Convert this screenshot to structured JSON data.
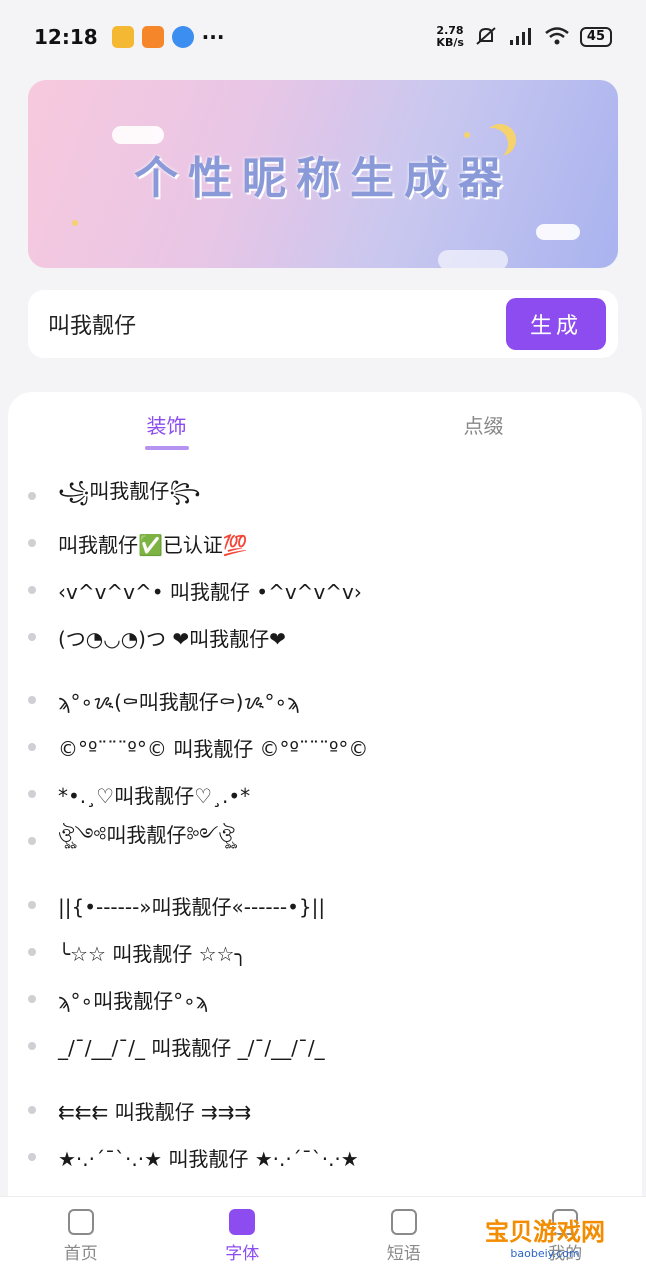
{
  "status": {
    "time": "12:18",
    "more": "···",
    "net_speed_value": "2.78",
    "net_speed_unit": "KB/s",
    "battery": "45"
  },
  "banner": {
    "title": "个性昵称生成器"
  },
  "input": {
    "value": "叫我靓仔",
    "generate_label": "生成"
  },
  "tabs": [
    {
      "label": "装饰"
    },
    {
      "label": "点缀"
    }
  ],
  "results": [
    "꧁叫我靓仔꧂",
    "叫我靓仔✅已认证💯",
    "‹v^v^v^• 叫我靓仔 •^v^v^v›",
    "(つ◔◡◔)つ ❤叫我靓仔❤",
    "ϡ°∘ᝰ(⚰叫我靓仔⚰)ᝰ°∘ϡ",
    "©°º¨¨¨º°© 叫我靓仔 ©°º¨¨¨º°©",
    "*•.¸♡叫我靓仔♡¸.•*",
    "ঔৣ༺叫我靓仔༻ঔৣ",
    "||{•------»叫我靓仔«------•}||",
    "╰☆☆ 叫我靓仔 ☆☆╮",
    "ϡ°∘叫我靓仔°∘ϡ",
    "_/¯/__/¯/_ 叫我靓仔 _/¯/__/¯/_",
    "⇇⇇⇇ 叫我靓仔 ⇉⇉⇉",
    "★·.·´¯`·.·★ 叫我靓仔 ★·.·´¯`·.·★"
  ],
  "nav": [
    {
      "label": "首页"
    },
    {
      "label": "字体"
    },
    {
      "label": "短语"
    },
    {
      "label": "我的"
    }
  ],
  "watermark": {
    "text": "宝贝游戏网",
    "url": "baobeiy.com"
  },
  "colors": {
    "accent": "#8c4cf0",
    "tab_indicator": "#b693f0"
  }
}
